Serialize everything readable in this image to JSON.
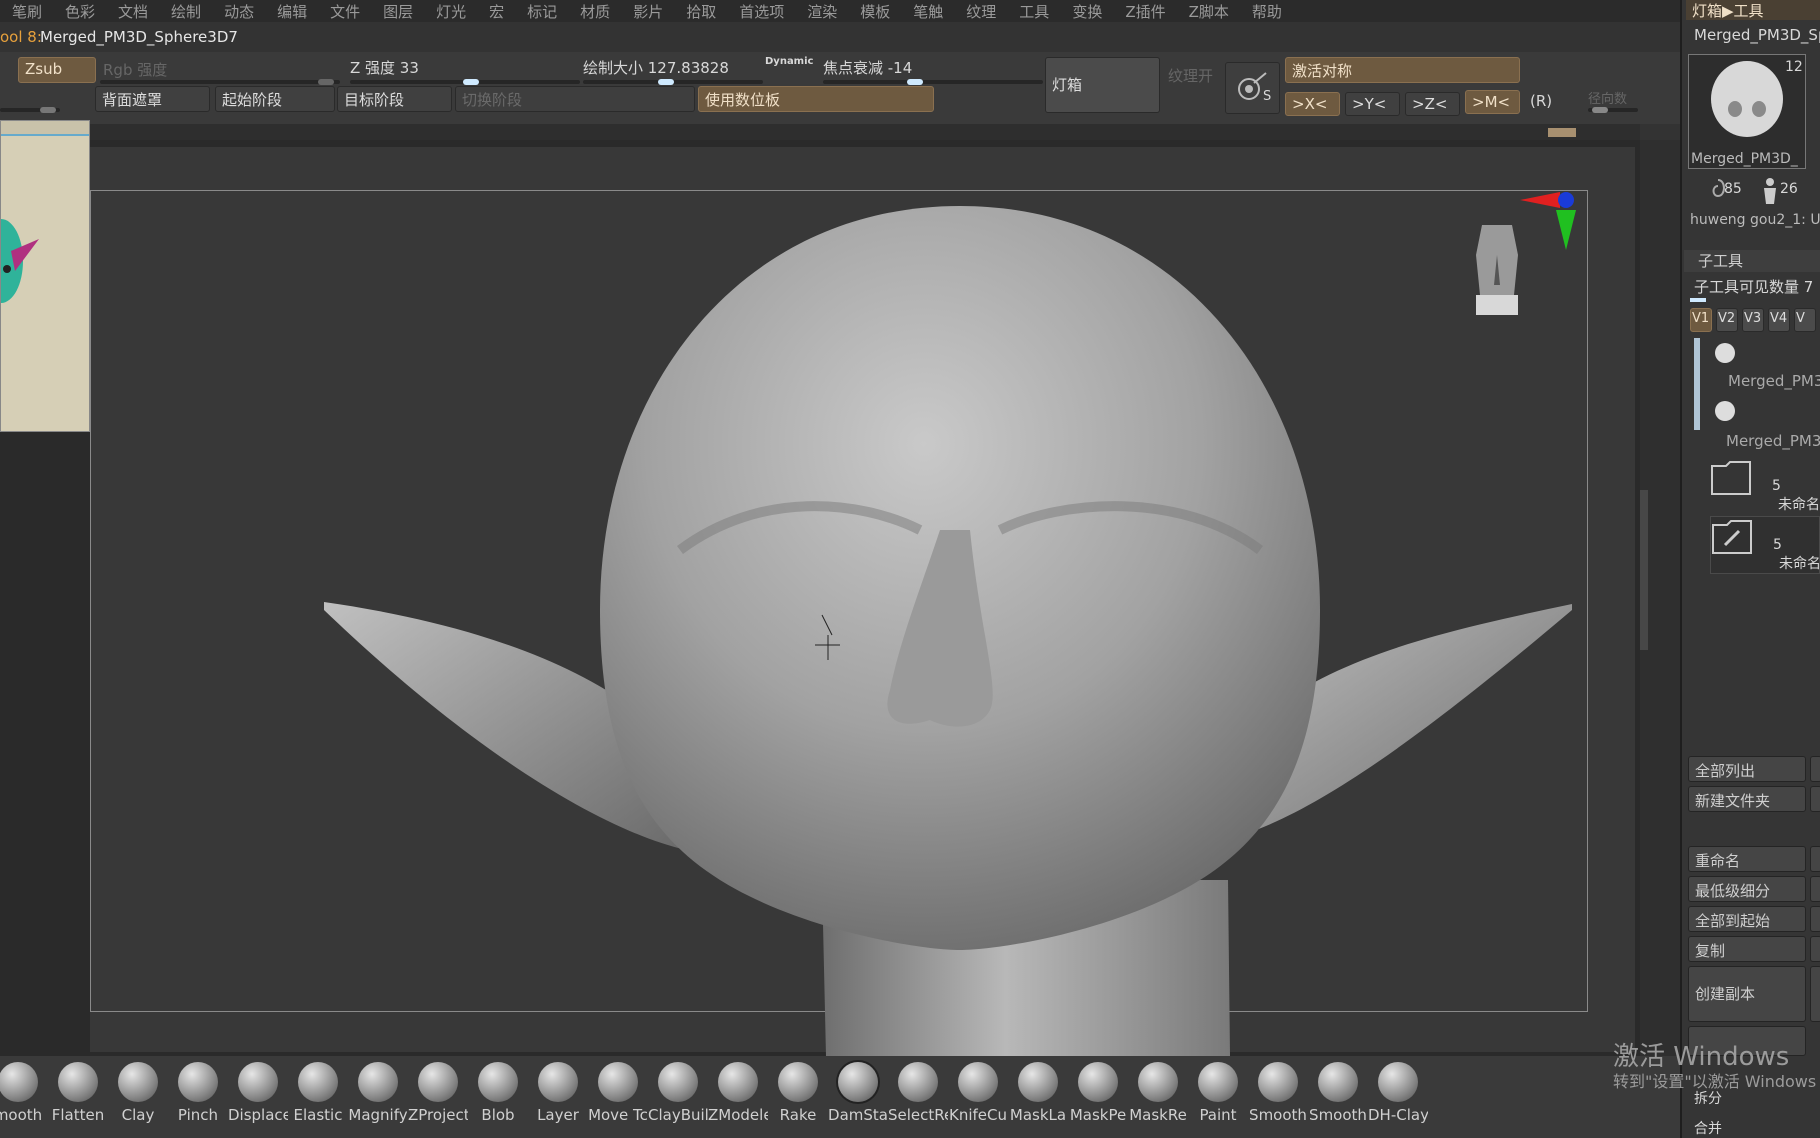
{
  "menu": [
    "笔刷",
    "色彩",
    "文档",
    "绘制",
    "动态",
    "编辑",
    "文件",
    "图层",
    "灯光",
    "宏",
    "标记",
    "材质",
    "影片",
    "拾取",
    "首选项",
    "渲染",
    "模板",
    "笔触",
    "纹理",
    "工具",
    "变换",
    "Z插件",
    "Z脚本",
    "帮助"
  ],
  "tool": {
    "prefix": "ool 8:",
    "name": "Merged_PM3D_Sphere3D7"
  },
  "shelf": {
    "zsub": "Zsub",
    "rgb": "Rgb 强度",
    "z_intensity": "Z 强度 33",
    "draw_size": "绘制大小 127.83828",
    "dynamic": "Dynamic",
    "focal": "焦点衰减 -14",
    "backface": "背面遮罩",
    "start_stage": "起始阶段",
    "target_stage": "目标阶段",
    "switch_stage": "切换阶段",
    "tablet": "使用数位板",
    "lightbox": "灯箱",
    "texture_on": "纹理开",
    "symmetry": "激活对称",
    "sym_x": ">X<",
    "sym_y": ">Y<",
    "sym_z": ">Z<",
    "sym_m": ">M<",
    "sym_r": "(R)",
    "radial": "径向数",
    "s_label": "S"
  },
  "right": {
    "breadcrumb": "灯箱▶工具",
    "tool_name": "Merged_PM3D_Sp",
    "count_main": "12",
    "thumb_label": "Merged_PM3D_",
    "small1_count": "85",
    "small2_count": "26",
    "small_labels": "huweng gou2_1: U",
    "subtool_header": "子工具",
    "visible_count": "子工具可见数量 7",
    "v_tabs": [
      "V1",
      "V2",
      "V3",
      "V4",
      "V"
    ],
    "sub1": "Merged_PM3",
    "sub2": "Merged_PM3",
    "folder1_count": "5",
    "folder1_name": "未命名",
    "folder2_count": "5",
    "folder2_name": "未命名",
    "list_all": "全部列出",
    "new_folder": "新建文件夹",
    "rename": "重命名",
    "lowest": "最低级细分",
    "all_to_start": "全部到起始",
    "copy": "复制",
    "create_copy": "创建副本",
    "split": "拆分",
    "merge": "合并"
  },
  "brushes": [
    "mooth",
    "Flatten",
    "Clay",
    "Pinch",
    "Displace",
    "Elastic",
    "Magnify",
    "ZProject",
    "Blob",
    "Layer",
    "Move Tc",
    "ClayBuil",
    "ZModele",
    "Rake",
    "DamSta",
    "SelectRe",
    "KnifeCu",
    "MaskLa",
    "MaskPe",
    "MaskRe",
    "Paint",
    "Smooth",
    "Smooth",
    "DH-Clay"
  ],
  "watermark": {
    "line1": "激活 Windows",
    "line2": "转到\"设置\"以激活 Windows"
  }
}
